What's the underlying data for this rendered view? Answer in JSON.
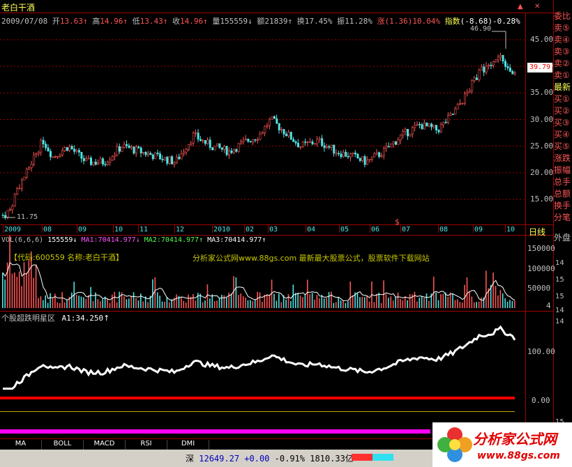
{
  "stock": {
    "name": "老白干酒",
    "date": "2009/07/08",
    "open_label": "开",
    "open": "13.63",
    "high_label": "高",
    "high": "14.96",
    "low_label": "低",
    "low": "13.43",
    "close_label": "收",
    "close": "14.96",
    "volume_label": "量",
    "volume": "155559",
    "amount_label": "额",
    "amount": "21839",
    "turnover_label": "换",
    "turnover": "17.45%",
    "amplitude_label": "振",
    "amplitude": "11.28%",
    "change_label": "涨",
    "change": "(1.36)",
    "change_pct": "10.04%",
    "index_label": "指数",
    "index": "(-8.68)",
    "index_pct": "-0.28%"
  },
  "price_chart": {
    "y_ticks": [
      "45.00",
      "40.00",
      "35.00",
      "30.00",
      "25.00",
      "20.00",
      "15.00"
    ],
    "max_marker": "46.90",
    "min_marker": "11.75",
    "current_price": "39.79",
    "date_axis": [
      "2009",
      "08",
      "09",
      "10",
      "11",
      "12",
      "2010",
      "02",
      "03",
      "04",
      "05",
      "06",
      "07",
      "08",
      "09",
      "10"
    ],
    "period": "日线",
    "dollar_marker": "$"
  },
  "volume_panel": {
    "header_name": "VOL(6,6,6)",
    "header_value": "155559",
    "ma1": "MA1:70414.977",
    "ma2": "MA2:70414.977",
    "ma3": "MA3:70414.977",
    "code_label": "【代码:600559 名称:老白干酒】",
    "promo": "分析家公式网www.88gs.com 最新最大股票公式，股票软件下载网站",
    "y_ticks": [
      "150000",
      "100000",
      "50000"
    ],
    "y_bottom": "4"
  },
  "indicator_panel": {
    "name": "个股超跌明星区",
    "a1": "A1:34.250",
    "y_ticks": [
      "100.00",
      "0.00"
    ]
  },
  "right_panel": {
    "items": [
      "委比",
      "卖⑤",
      "卖④",
      "卖③",
      "卖②",
      "卖①",
      "最新",
      "买①",
      "买②",
      "买③",
      "买④",
      "买⑤",
      "涨跌",
      "振幅",
      "总手",
      "总额",
      "换手",
      "分笔",
      "外盘"
    ],
    "right_axis_vals": [
      "14",
      "15",
      "15",
      "14",
      "14",
      "15"
    ]
  },
  "tabs": [
    "MA",
    "BOLL",
    "MACD",
    "RSI",
    "DMI"
  ],
  "status_bar": {
    "market": "深",
    "index_value": "12649.27",
    "index_change": "+0.00",
    "index_pct": "-0.91%",
    "turnover": "1810.33亿"
  },
  "watermark": {
    "title": "分析家公式网",
    "url": "www.88gs.com"
  },
  "window_controls": {
    "restore": "▲",
    "close": "✕"
  },
  "colors": {
    "up": "#ff5555",
    "down": "#4fe4e4",
    "grid": "#a00000",
    "indicator_line": "#ffffff",
    "zero_line": "#ff0000",
    "magenta_bar": "#ff00ff"
  }
}
